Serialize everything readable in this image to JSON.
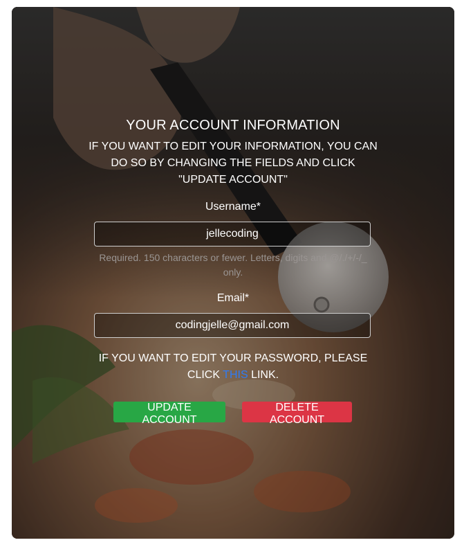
{
  "page": {
    "title": "YOUR ACCOUNT INFORMATION",
    "subtitle": "IF YOU WANT TO EDIT YOUR INFORMATION, YOU CAN DO SO BY CHANGING THE FIELDS AND CLICK \"UPDATE ACCOUNT\""
  },
  "form": {
    "username": {
      "label": "Username*",
      "value": "jellecoding",
      "help": "Required. 150 characters or fewer. Letters, digits and @/./+/-/_ only."
    },
    "email": {
      "label": "Email*",
      "value": "codingjelle@gmail.com"
    }
  },
  "password_note": {
    "before": "IF YOU WANT TO EDIT YOUR PASSWORD, PLEASE CLICK",
    "link": "THIS",
    "after": "LINK."
  },
  "buttons": {
    "update_label": "UPDATE ACCOUNT",
    "delete_label": "DELETE ACCOUNT"
  },
  "colors": {
    "update_button": "#28a745",
    "delete_button": "#dc3545",
    "link": "#2f7bf5"
  }
}
